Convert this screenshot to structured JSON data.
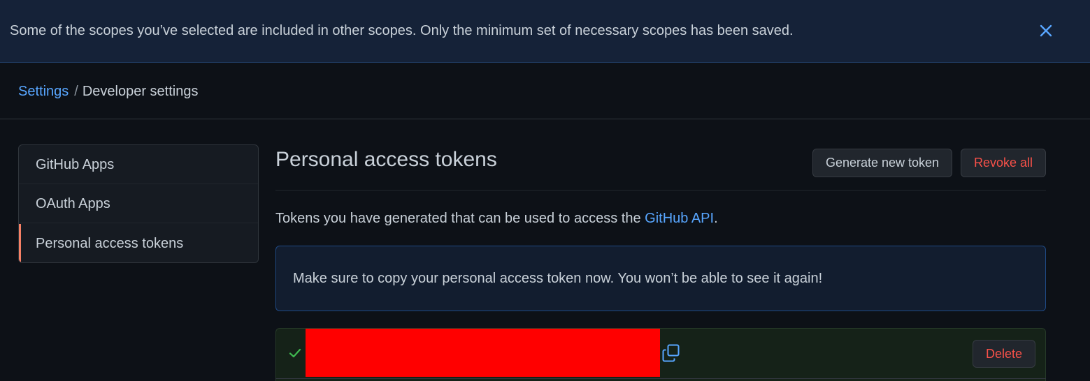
{
  "flash": {
    "message": "Some of the scopes you’ve selected are included in other scopes. Only the minimum set of necessary scopes has been saved.",
    "close_icon": "close-icon"
  },
  "breadcrumb": {
    "root": "Settings",
    "separator": "/",
    "current": "Developer settings"
  },
  "sidenav": {
    "items": [
      {
        "label": "GitHub Apps",
        "active": false
      },
      {
        "label": "OAuth Apps",
        "active": false
      },
      {
        "label": "Personal access tokens",
        "active": true
      }
    ]
  },
  "main": {
    "title": "Personal access tokens",
    "generate_label": "Generate new token",
    "revoke_label": "Revoke all",
    "description_prefix": "Tokens you have generated that can be used to access the ",
    "description_link": "GitHub API",
    "description_suffix": ".",
    "notice": "Make sure to copy your personal access token now. You won’t be able to see it again!",
    "token": {
      "status_icon": "check-icon",
      "redacted": true,
      "copy_icon": "copy-icon",
      "delete_label": "Delete"
    }
  },
  "colors": {
    "background": "#0d1117",
    "link": "#58a6ff",
    "danger": "#f85149",
    "active_indicator": "#f78166",
    "success": "#3fb950",
    "redaction": "#ff0000"
  }
}
